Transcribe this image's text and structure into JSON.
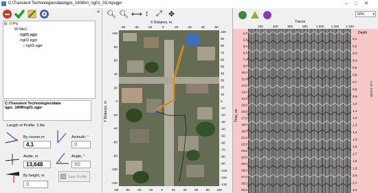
{
  "window": {
    "title": "C:\\Transient Technologies\\data\\gps_1808\\m_ng01_03.mpsgpr",
    "controls": [
      "–",
      "□",
      "✕"
    ]
  },
  "tree": {
    "root": "Prj",
    "site": "Site1",
    "files": [
      "ng01.sgpr",
      "ng02.sgpr",
      "ng03.sgpr"
    ]
  },
  "profile": {
    "path_line1": "C:\\Transient Technologies\\data",
    "path_line2": "\\gps_1808\\ng01.sgpr",
    "length_label": "Length of Profile: 2,9m",
    "by_course_label": "By course,m",
    "by_course_value": "4,1",
    "azimuth_label": "Azimuth, °",
    "azimuth_value": "0",
    "aside_label": "Aside, m",
    "aside_value": "13,648",
    "angle_label": "Angle, °",
    "angle_value": "90",
    "by_height_label": "By height, m",
    "by_height_value": "0",
    "save_label": "Save Profile"
  },
  "map": {
    "x_axis_label": "X Distance, m",
    "y_axis_label": "Y Distance, m",
    "x_ticks_top": [
      "-60",
      "-40",
      "-20",
      "0",
      "20",
      "40",
      "60",
      "80"
    ],
    "x_ticks_bottom": [
      "-80",
      "-60",
      "-40",
      "-20",
      "0",
      "20",
      "40",
      "60",
      "80",
      "100"
    ],
    "y_ticks_left": [
      "100",
      "80",
      "60",
      "40",
      "20",
      "0",
      "-20",
      "-40",
      "-60",
      "-80",
      "-100",
      "-120"
    ],
    "y_ticks_right": [
      "100",
      "90",
      "80",
      "70",
      "60",
      "50",
      "40",
      "30",
      "20",
      "10",
      "0",
      "-10",
      "-20",
      "-30",
      "-40",
      "-50",
      "-60",
      "-70",
      "-80",
      "-90",
      "-100",
      "-110",
      "-120"
    ]
  },
  "radar": {
    "zoom": "50%",
    "traces_label": "Traces",
    "trace_ticks": [
      "200",
      "400",
      "600",
      "800",
      "1 000",
      "1 200",
      "1 400"
    ],
    "time_label": "Time, ns",
    "depth_label": "Depth",
    "epsilon_label": "ε=4, ε=0,02",
    "time_ticks": [
      "1,0",
      "3,0",
      "5,0",
      "6,0",
      "7,0",
      "8,0",
      "10,0",
      "11,0",
      "12,0",
      "13,0",
      "14,0",
      "15,0",
      "16,0",
      "17,0",
      "18,0",
      "19,0",
      "21,0",
      "22,0",
      "23,0",
      "24,0",
      "25,0",
      "26,0",
      "27,0",
      "28,0",
      "29,0"
    ],
    "depth_ticks": [
      "0,1",
      "0,2",
      "0,3",
      "0,4",
      "0,5",
      "0,6",
      "0,7",
      "0,8",
      "0,9",
      "1,0",
      "1,1",
      "1,2",
      "1,3",
      "1,4",
      "1,5",
      "1,6",
      "1,7",
      "1,8",
      "1,9",
      "2,0",
      "2,1",
      "2,2"
    ]
  },
  "colors": {
    "accent_red": "#d9302b",
    "track_yellow": "#ffe600",
    "track_red": "#c81e1e",
    "radar_axis_pink": "#f6c8c8"
  }
}
